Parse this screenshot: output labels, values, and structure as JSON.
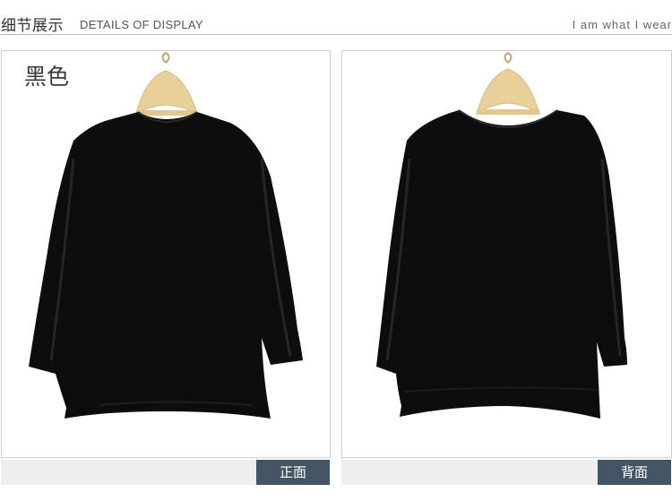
{
  "header": {
    "title_cn": "细节展示",
    "title_en": "DETAILS OF DISPLAY",
    "tagline": "I am what I wear"
  },
  "color_label": "黑色",
  "views": {
    "front_label": "正面",
    "back_label": "背面"
  },
  "colors": {
    "garment": "#0d0d0d",
    "hanger": "#e9cf9a",
    "button_bg": "#445566",
    "caption_bg": "#eeeeee"
  },
  "icons": {
    "front_image": "black-chiffon-blouse-front",
    "back_image": "black-chiffon-blouse-back",
    "hanger": "wooden-hanger-icon"
  }
}
